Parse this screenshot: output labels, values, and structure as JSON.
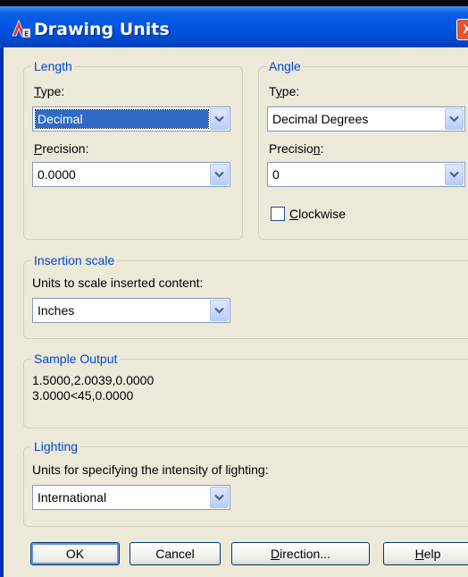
{
  "window": {
    "title": "Drawing Units",
    "close_glyph": "X",
    "app_icon": "autocad-icon"
  },
  "length": {
    "legend": "Length",
    "type_label": "Type:",
    "type_value": "Decimal",
    "precision_label": "Precision:",
    "precision_value": "0.0000"
  },
  "angle": {
    "legend": "Angle",
    "type_label": "Type:",
    "type_value": "Decimal Degrees",
    "precision_label": "Precision:",
    "precision_value": "0",
    "clockwise_label": "Clockwise",
    "clockwise_checked": false
  },
  "insertion": {
    "legend": "Insertion scale",
    "label": "Units to scale inserted content:",
    "value": "Inches"
  },
  "sample": {
    "legend": "Sample Output",
    "line1": "1.5000,2.0039,0.0000",
    "line2": "3.0000<45,0.0000"
  },
  "lighting": {
    "legend": "Lighting",
    "label": "Units for specifying the intensity of lighting:",
    "value": "International"
  },
  "buttons": {
    "ok": "OK",
    "cancel": "Cancel",
    "direction": "Direction...",
    "help": "Help"
  },
  "colors": {
    "title_bar": "#0054e3",
    "legend_text": "#0046d5",
    "dialog_bg": "#ece9d8",
    "selection": "#316ac5"
  }
}
